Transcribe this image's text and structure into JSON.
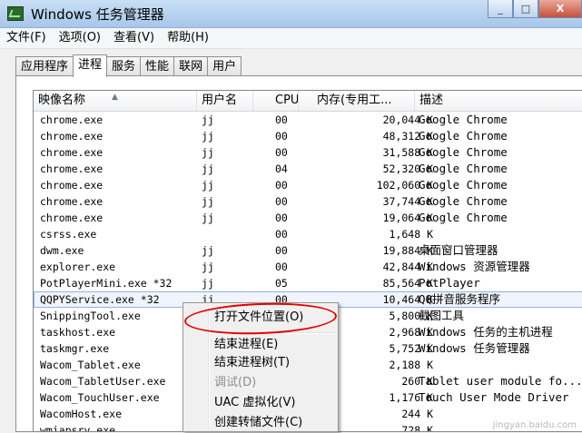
{
  "window": {
    "title": "Windows 任务管理器",
    "minimize_label": "_",
    "maximize_label": "□",
    "close_label": "X"
  },
  "menu": [
    "文件(F)",
    "选项(O)",
    "查看(V)",
    "帮助(H)"
  ],
  "tabs": [
    {
      "label": "应用程序",
      "active": false
    },
    {
      "label": "进程",
      "active": true
    },
    {
      "label": "服务",
      "active": false
    },
    {
      "label": "性能",
      "active": false
    },
    {
      "label": "联网",
      "active": false
    },
    {
      "label": "用户",
      "active": false
    }
  ],
  "columns": {
    "name": "映像名称",
    "user": "用户名",
    "cpu": "CPU",
    "mem": "内存(专用工...",
    "desc": "描述"
  },
  "processes": [
    {
      "name": "chrome.exe",
      "user": "jj",
      "cpu": "00",
      "mem": "20,044 K",
      "desc": "Google Chrome"
    },
    {
      "name": "chrome.exe",
      "user": "jj",
      "cpu": "00",
      "mem": "48,312 K",
      "desc": "Google Chrome"
    },
    {
      "name": "chrome.exe",
      "user": "jj",
      "cpu": "00",
      "mem": "31,588 K",
      "desc": "Google Chrome"
    },
    {
      "name": "chrome.exe",
      "user": "jj",
      "cpu": "04",
      "mem": "52,320 K",
      "desc": "Google Chrome"
    },
    {
      "name": "chrome.exe",
      "user": "jj",
      "cpu": "00",
      "mem": "102,060 K",
      "desc": "Google Chrome"
    },
    {
      "name": "chrome.exe",
      "user": "jj",
      "cpu": "00",
      "mem": "37,744 K",
      "desc": "Google Chrome"
    },
    {
      "name": "chrome.exe",
      "user": "jj",
      "cpu": "00",
      "mem": "19,064 K",
      "desc": "Google Chrome"
    },
    {
      "name": "csrss.exe",
      "user": "",
      "cpu": "00",
      "mem": "1,648 K",
      "desc": ""
    },
    {
      "name": "dwm.exe",
      "user": "jj",
      "cpu": "00",
      "mem": "19,884 K",
      "desc": "桌面窗口管理器"
    },
    {
      "name": "explorer.exe",
      "user": "jj",
      "cpu": "00",
      "mem": "42,844 K",
      "desc": "Windows 资源管理器"
    },
    {
      "name": "PotPlayerMini.exe *32",
      "user": "jj",
      "cpu": "05",
      "mem": "85,564 K",
      "desc": "PotPlayer"
    },
    {
      "name": "QQPYService.exe *32",
      "user": "jj",
      "cpu": "00",
      "mem": "10,464 K",
      "desc": "QQ拼音服务程序",
      "selected": true
    },
    {
      "name": "SnippingTool.exe",
      "user": "",
      "cpu": "",
      "mem": "5,800 K",
      "desc": "截图工具"
    },
    {
      "name": "taskhost.exe",
      "user": "",
      "cpu": "",
      "mem": "2,968 K",
      "desc": "Windows 任务的主机进程"
    },
    {
      "name": "taskmgr.exe",
      "user": "",
      "cpu": "",
      "mem": "5,752 K",
      "desc": "Windows 任务管理器"
    },
    {
      "name": "Wacom_Tablet.exe",
      "user": "",
      "cpu": "",
      "mem": "2,188 K",
      "desc": ""
    },
    {
      "name": "Wacom_TabletUser.exe",
      "user": "",
      "cpu": "",
      "mem": "260 K",
      "desc": "Tablet user module fo..."
    },
    {
      "name": "Wacom_TouchUser.exe",
      "user": "",
      "cpu": "",
      "mem": "1,176 K",
      "desc": "Touch User Mode Driver"
    },
    {
      "name": "WacomHost.exe",
      "user": "",
      "cpu": "",
      "mem": "244 K",
      "desc": ""
    },
    {
      "name": "wmiapsrv.exe",
      "user": "",
      "cpu": "",
      "mem": "728 K",
      "desc": ""
    }
  ],
  "context_menu": {
    "items": [
      {
        "label": "打开文件位置(O)",
        "enabled": true
      },
      {
        "label": "结束进程(E)",
        "enabled": true
      },
      {
        "label": "结束进程树(T)",
        "enabled": true
      },
      {
        "label": "调试(D)",
        "enabled": false
      },
      {
        "label": "UAC 虚拟化(V)",
        "enabled": true
      },
      {
        "label": "创建转储文件(C)",
        "enabled": true
      }
    ]
  },
  "watermark": "jingyan.baidu.com"
}
